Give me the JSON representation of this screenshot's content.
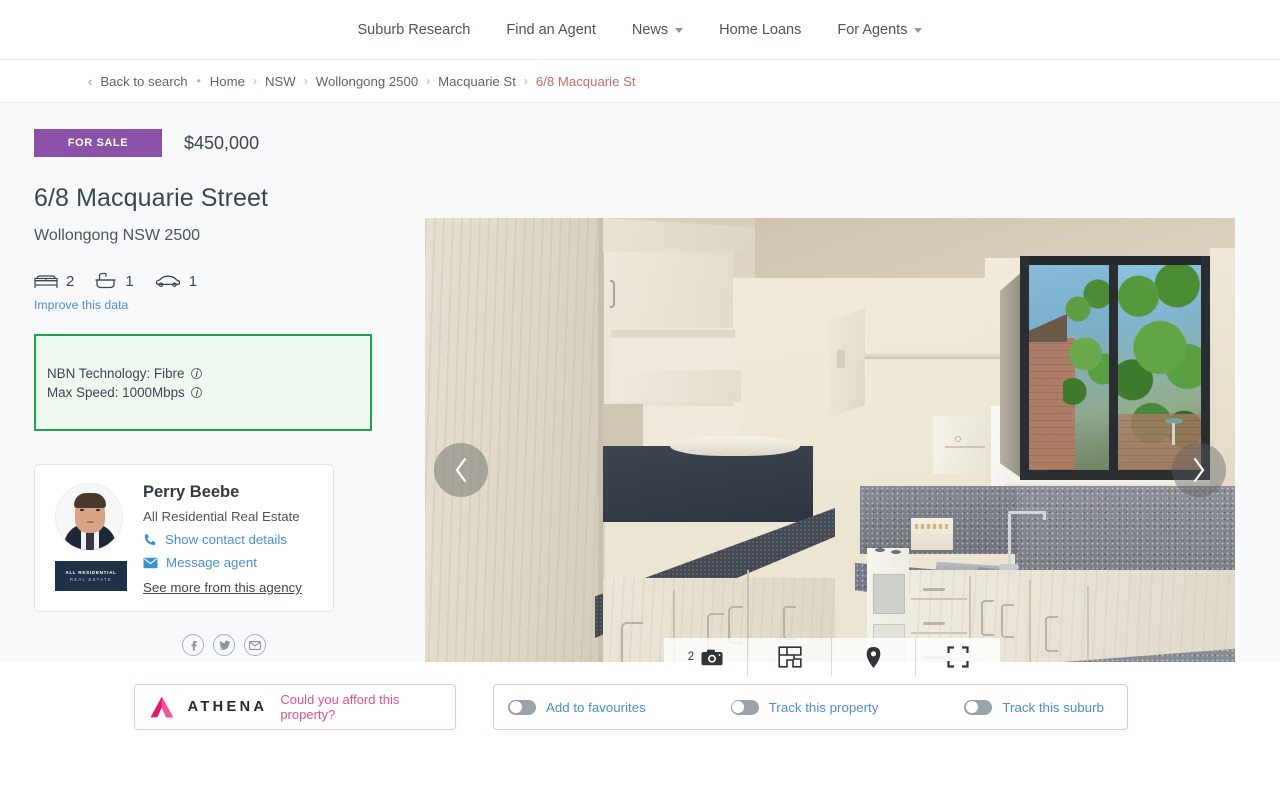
{
  "topnav": {
    "items": [
      {
        "label": "Suburb Research",
        "caret": false
      },
      {
        "label": "Find an Agent",
        "caret": false
      },
      {
        "label": "News",
        "caret": true
      },
      {
        "label": "Home Loans",
        "caret": false
      },
      {
        "label": "For Agents",
        "caret": true
      }
    ]
  },
  "breadcrumb": {
    "back_label": "Back to search",
    "back_arrow": "‹",
    "dot": "•",
    "separator": "›",
    "items": [
      {
        "label": "Home"
      },
      {
        "label": "NSW"
      },
      {
        "label": "Wollongong 2500"
      },
      {
        "label": "Macquarie St"
      },
      {
        "label": "6/8 Macquarie St"
      }
    ]
  },
  "listing": {
    "status_badge": "FOR SALE",
    "price": "$450,000",
    "address_line1": "6/8 Macquarie Street",
    "address_line2": "Wollongong NSW 2500",
    "features": [
      {
        "icon": "bed-icon",
        "value": "2"
      },
      {
        "icon": "bath-icon",
        "value": "1"
      },
      {
        "icon": "car-icon",
        "value": "1"
      }
    ],
    "improve_data_label": "Improve this data",
    "nbn": {
      "technology_line": "NBN Technology: Fibre",
      "speed_line": "Max Speed: 1000Mbps",
      "info_glyph": "i",
      "border_color": "#1fa34a",
      "fill_color": "#eefaf0"
    },
    "badge_color": "#8b51a8"
  },
  "agent": {
    "name": "Perry Beebe",
    "agency": "All Residential Real Estate",
    "contact_link": "Show contact details",
    "message_link": "Message agent",
    "more_link": "See more from this agency",
    "logo_line1": "ALL RESIDENTIAL",
    "logo_line2": "REAL ESTATE",
    "phone_icon": "phone-icon",
    "envelope_icon": "envelope-icon"
  },
  "social": {
    "items": [
      {
        "icon": "facebook-icon",
        "glyph": "f"
      },
      {
        "icon": "twitter-icon",
        "glyph": "t"
      },
      {
        "icon": "email-icon",
        "glyph": "e"
      }
    ]
  },
  "gallery": {
    "prev_label": "‹",
    "next_label": "›",
    "photo_count": "2",
    "buttons": [
      {
        "name": "photo-count-button",
        "icon": "camera-icon",
        "count": "2"
      },
      {
        "name": "floorplan-button",
        "icon": "floorplan-icon",
        "count": ""
      },
      {
        "name": "map-button",
        "icon": "map-pin-icon",
        "count": ""
      },
      {
        "name": "fullscreen-button",
        "icon": "fullscreen-icon",
        "count": ""
      }
    ]
  },
  "athena": {
    "brand": "ATHENA",
    "question": "Could you afford this property?",
    "logo_icon": "athena-logo-icon",
    "accent_color": "#e0537f"
  },
  "tracking": {
    "items": [
      {
        "label": "Add to favourites",
        "on": false
      },
      {
        "label": "Track this property",
        "on": false
      },
      {
        "label": "Track this suburb",
        "on": false
      }
    ]
  },
  "colors": {
    "page_band": "#f8f9fb",
    "link_blue": "#4a8fd4",
    "crumb_active": "#cb6b6b"
  }
}
